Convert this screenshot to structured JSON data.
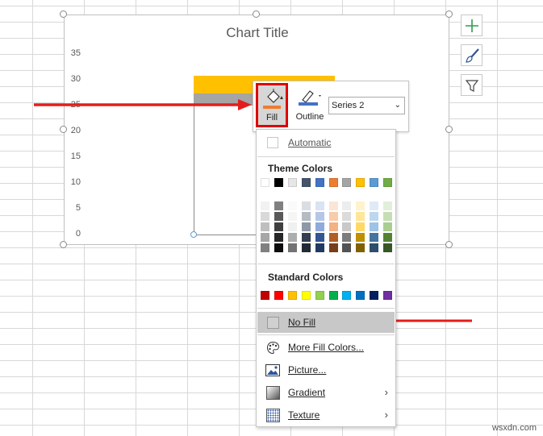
{
  "chart": {
    "title": "Chart Title",
    "y_ticks": [
      "35",
      "30",
      "25",
      "20",
      "15",
      "10",
      "5",
      "0"
    ]
  },
  "chart_data": {
    "type": "bar",
    "title": "Chart Title",
    "ylim": [
      0,
      35
    ],
    "series": [
      {
        "values": [
          30
        ],
        "color": "#ffc000"
      },
      {
        "values": [
          27
        ],
        "color": "#a5a5a5"
      }
    ]
  },
  "side_buttons": {
    "elements": "plus-icon",
    "styles": "brush-icon",
    "filters": "funnel-icon"
  },
  "toolbar": {
    "fill_label": "Fill",
    "outline_label": "Outline",
    "series_value": "Series 2",
    "fill_color": "#ed7d31",
    "outline_color": "#4472c4"
  },
  "menu": {
    "automatic": "Automatic",
    "theme_header": "Theme Colors",
    "standard_header": "Standard Colors",
    "theme_colors": [
      "#ffffff",
      "#000000",
      "#e7e6e6",
      "#44546a",
      "#4472c4",
      "#ed7d31",
      "#a5a5a5",
      "#ffc000",
      "#5b9bd5",
      "#70ad47"
    ],
    "standard_colors": [
      "#c00000",
      "#ff0000",
      "#ffc000",
      "#ffff00",
      "#92d050",
      "#00b050",
      "#00b0f0",
      "#0070c0",
      "#002060",
      "#7030a0"
    ],
    "no_fill": "No Fill",
    "more_colors": "More Fill Colors...",
    "picture": "Picture...",
    "gradient": "Gradient",
    "texture": "Texture"
  },
  "watermark": "wsxdn.com"
}
